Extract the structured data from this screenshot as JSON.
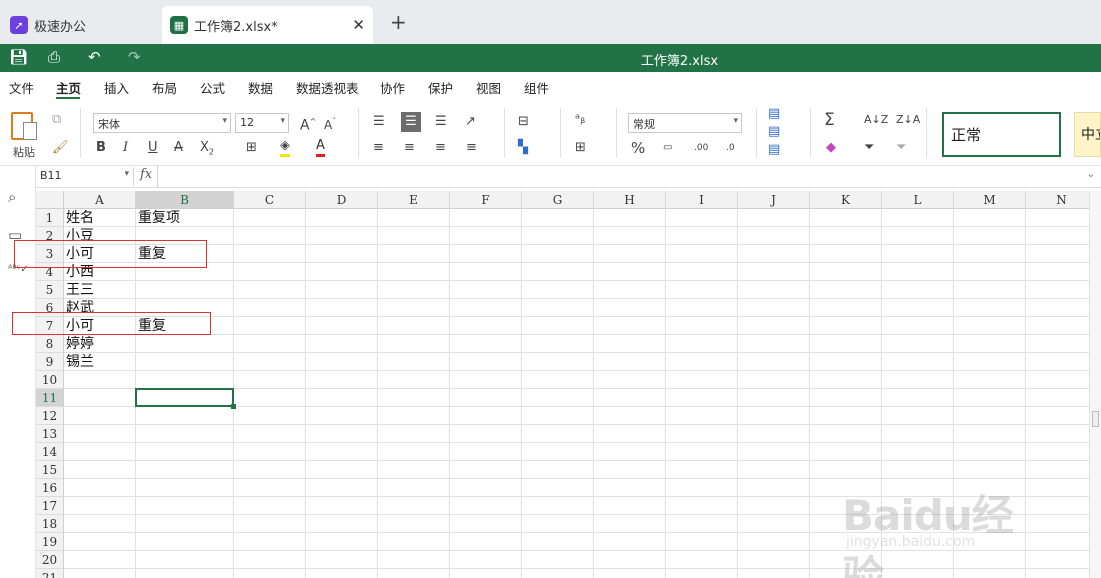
{
  "tabs": [
    {
      "label": "极速办公",
      "icon": "rocket-icon",
      "color": "#6b3fe0"
    },
    {
      "label": "工作簿2.xlsx*",
      "icon": "spreadsheet-icon",
      "color": "#1e7145"
    }
  ],
  "header": {
    "title": "工作簿2.xlsx",
    "color": "#217346"
  },
  "menu": [
    "文件",
    "主页",
    "插入",
    "布局",
    "公式",
    "数据",
    "数据透视表",
    "协作",
    "保护",
    "视图",
    "组件"
  ],
  "ribbon": {
    "paste_label": "粘贴",
    "font_name": "宋体",
    "font_size": "12",
    "number_format": "常规",
    "style_normal": "正常",
    "style_neutral": "中立"
  },
  "formula_bar": {
    "name_box": "B11",
    "fx": "fx",
    "value": ""
  },
  "columns": [
    "A",
    "B",
    "C",
    "D",
    "E",
    "F",
    "G",
    "H",
    "I",
    "J",
    "K",
    "L",
    "M",
    "N"
  ],
  "rows": [
    "1",
    "2",
    "3",
    "4",
    "5",
    "6",
    "7",
    "8",
    "9",
    "10",
    "11",
    "12",
    "13",
    "14",
    "15",
    "16",
    "17",
    "18",
    "19",
    "20",
    "21"
  ],
  "cells": {
    "A1": "姓名",
    "B1": "重复项",
    "A2": "小豆",
    "A3": "小可",
    "B3": "重复",
    "A4": "小西",
    "A5": "王三",
    "A6": "赵武",
    "A7": "小可",
    "B7": "重复",
    "A8": "婷婷",
    "A9": "锡兰"
  },
  "selected_cell": "B11",
  "watermark": {
    "text": "Baidu经验",
    "sub": "jingyan.baidu.com"
  }
}
